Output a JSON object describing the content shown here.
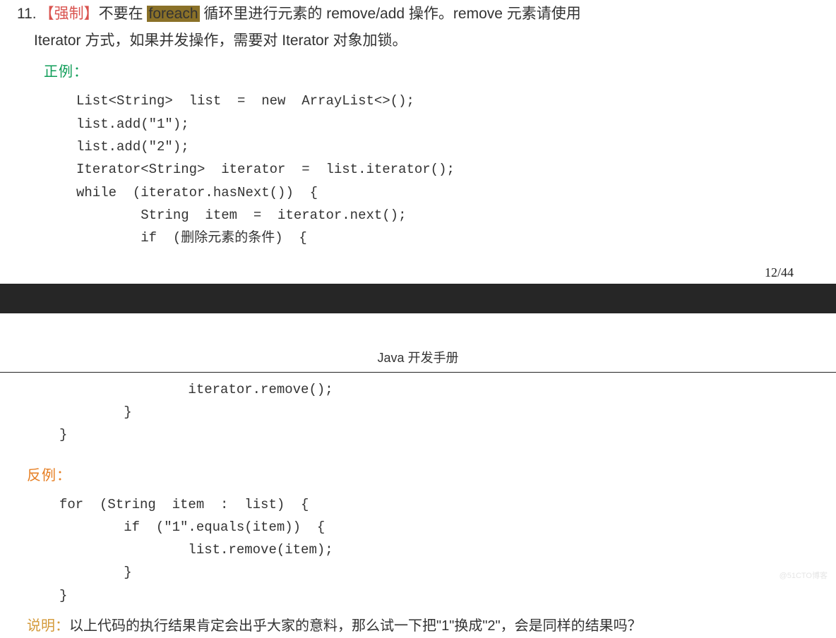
{
  "rule": {
    "number": "11.",
    "tag": "【强制】",
    "text_before_hl": "不要在 ",
    "highlight": "foreach",
    "text_after_hl": " 循环里进行元素的 remove/add 操作。remove 元素请使用",
    "line2": "Iterator 方式，如果并发操作，需要对 Iterator 对象加锁。"
  },
  "positive_label": "正例：",
  "code_positive_top": "List<String>  list  =  new  ArrayList<>();\nlist.add(\"1\");\nlist.add(\"2\");\nIterator<String>  iterator  =  list.iterator();\nwhile  (iterator.hasNext())  {\n        String  item  =  iterator.next();\n        if  (删除元素的条件)  {",
  "page_num": "12/44",
  "page_header": "Java 开发手册",
  "code_positive_bottom": "                iterator.remove();\n        }\n}",
  "negative_label": "反例：",
  "code_negative": "for  (String  item  :  list)  {\n        if  (\"1\".equals(item))  {\n                list.remove(item);\n        }\n}",
  "explain": {
    "label": "说明：",
    "text": "以上代码的执行结果肯定会出乎大家的意料，那么试一下把\"1\"换成\"2\"，会是同样的结果吗？"
  },
  "watermark": "@51CTO博客"
}
